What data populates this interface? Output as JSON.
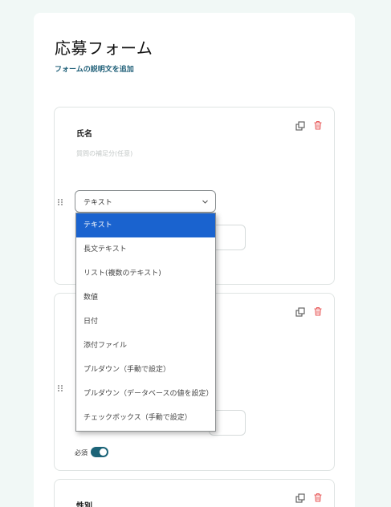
{
  "form": {
    "title": "応募フォーム",
    "add_description_link": "フォームの説明文を追加"
  },
  "fields": [
    {
      "label": "氏名",
      "help_placeholder": "質問の補足分(任意)",
      "type": "テキスト"
    },
    {
      "required_label": "必須",
      "required": true
    },
    {
      "label": "性別"
    }
  ],
  "type_dropdown": {
    "selected": "テキスト",
    "options": [
      "テキスト",
      "長文テキスト",
      "リスト(複数のテキスト)",
      "数値",
      "日付",
      "添付ファイル",
      "プルダウン（手動で設定）",
      "プルダウン（データベースの値を設定）",
      "チェックボックス（手動で設定）"
    ]
  },
  "colors": {
    "background": "#f1f8f6",
    "link": "#1f5f78",
    "toggle_on": "#1c6478",
    "delete_icon": "#e85a5a",
    "dropdown_highlight": "#1a63cf"
  },
  "icons": [
    "copy-icon",
    "trash-icon",
    "drag-handle-icon",
    "chevron-down-icon"
  ]
}
